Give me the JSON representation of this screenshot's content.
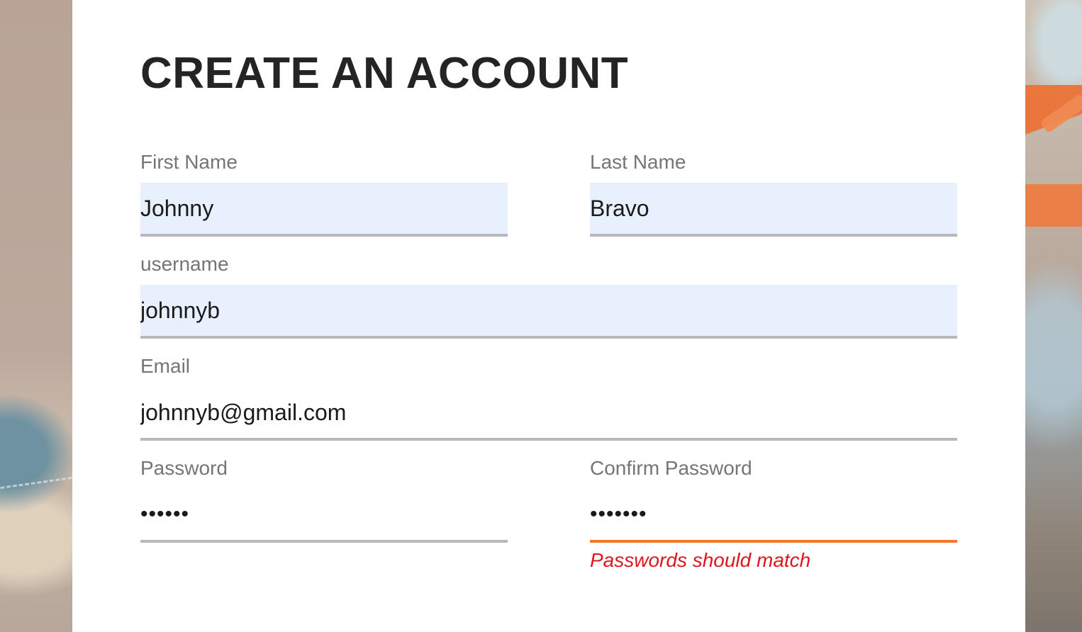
{
  "form": {
    "title": "CREATE AN ACCOUNT",
    "first_name": {
      "label": "First Name",
      "value": "Johnny",
      "autofilled": true
    },
    "last_name": {
      "label": "Last Name",
      "value": "Bravo",
      "autofilled": true
    },
    "username": {
      "label": "username",
      "value": "johnnyb",
      "autofilled": true
    },
    "email": {
      "label": "Email",
      "value": "johnnyb@gmail.com"
    },
    "password": {
      "label": "Password",
      "value": "••••••"
    },
    "confirm_password": {
      "label": "Confirm Password",
      "value": "•••••••",
      "error": "Passwords should match"
    }
  },
  "colors": {
    "title": "#242424",
    "label": "#74757a",
    "autofill_bg": "#e8f0fe",
    "underline": "#b8b8bc",
    "error_underline": "#f37a2d",
    "error_text": "#e0161e"
  }
}
